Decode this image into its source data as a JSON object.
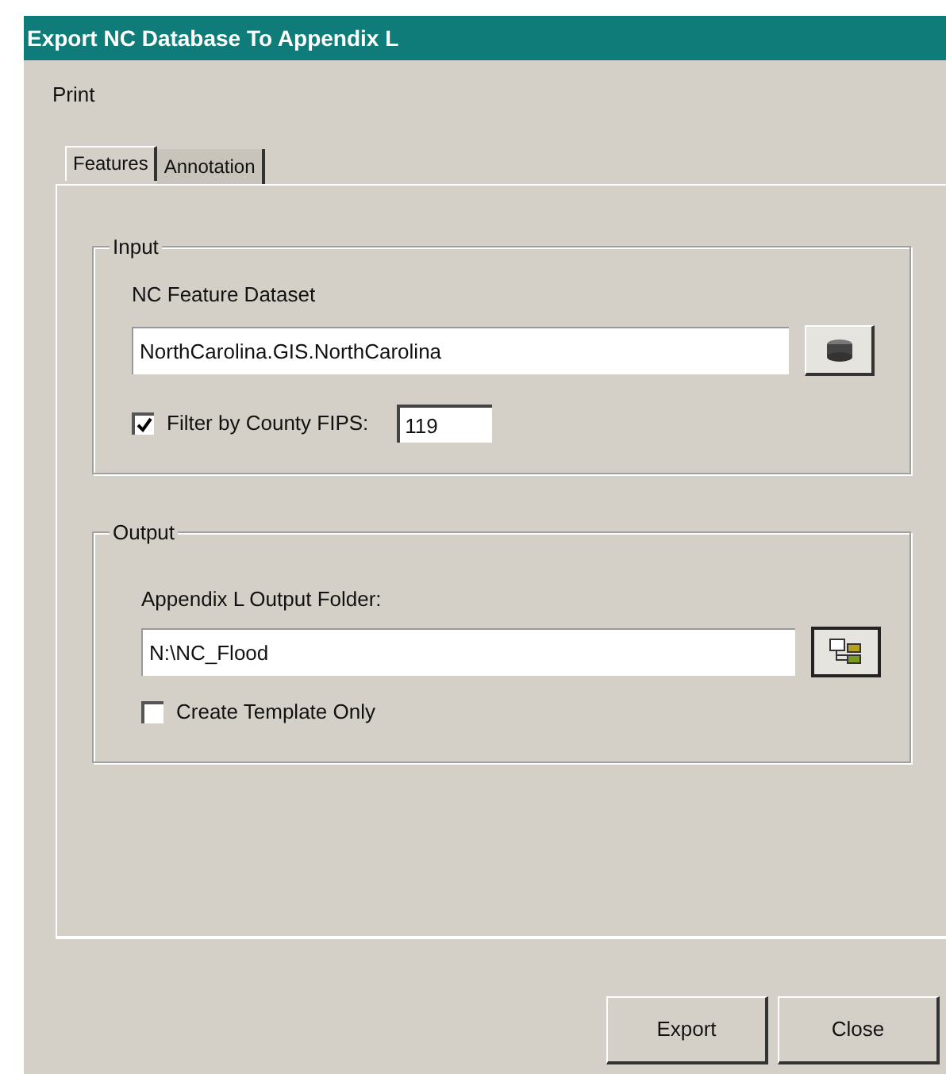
{
  "window": {
    "title": "Export NC Database To Appendix L"
  },
  "menu": [
    "Print"
  ],
  "tabs": [
    {
      "label": "Features",
      "selected": true
    },
    {
      "label": "Annotation",
      "selected": false
    }
  ],
  "input_group": {
    "title": "Input",
    "dataset_label": "NC Feature Dataset",
    "dataset_value": "NorthCarolina.GIS.NorthCarolina",
    "filter": {
      "label": "Filter by County FIPS:",
      "checked": true,
      "value": "119"
    }
  },
  "output_group": {
    "title": "Output",
    "folder_label": "Appendix L Output Folder:",
    "folder_value": "N:\\NC_Flood",
    "template": {
      "label": "Create Template Only",
      "checked": false
    }
  },
  "buttons": [
    "Export",
    "Close"
  ]
}
